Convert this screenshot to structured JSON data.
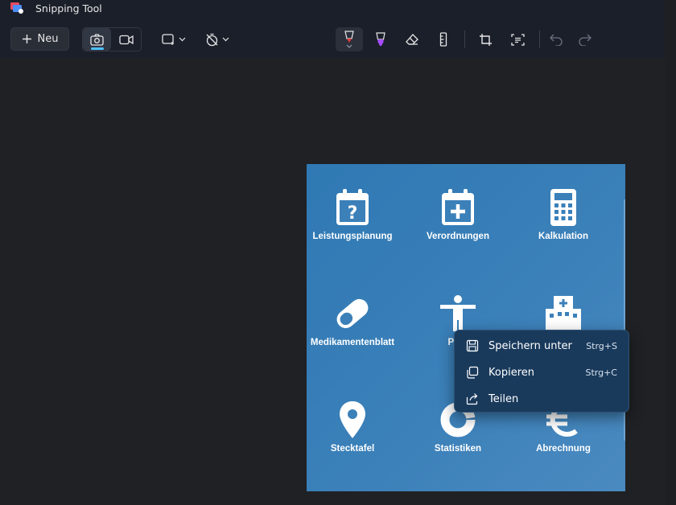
{
  "window": {
    "title": "Snipping Tool"
  },
  "toolbar": {
    "new_label": "Neu"
  },
  "capture": {
    "tiles": [
      {
        "label": "Leistungsplanung",
        "icon": "calendar-question-icon"
      },
      {
        "label": "Verordnungen",
        "icon": "calendar-plus-icon"
      },
      {
        "label": "Kalkulation",
        "icon": "calculator-icon"
      },
      {
        "label": "Medikamentenblatt",
        "icon": "pill-icon"
      },
      {
        "label": "Pers",
        "icon": "person-icon"
      },
      {
        "label": "",
        "icon": "building-icon"
      },
      {
        "label": "Stecktafel",
        "icon": "map-pin-icon"
      },
      {
        "label": "Statistiken",
        "icon": "donut-chart-icon"
      },
      {
        "label": "Abrechnung",
        "icon": "euro-icon"
      }
    ]
  },
  "context_menu": {
    "items": [
      {
        "label": "Speichern unter",
        "shortcut": "Strg+S",
        "icon": "save-icon"
      },
      {
        "label": "Kopieren",
        "shortcut": "Strg+C",
        "icon": "copy-icon"
      },
      {
        "label": "Teilen",
        "shortcut": "",
        "icon": "share-icon"
      }
    ]
  },
  "colors": {
    "accent": "#4cc2ff",
    "menu_bg": "#1a3a5c",
    "capture_bg": "#3b80b9"
  }
}
